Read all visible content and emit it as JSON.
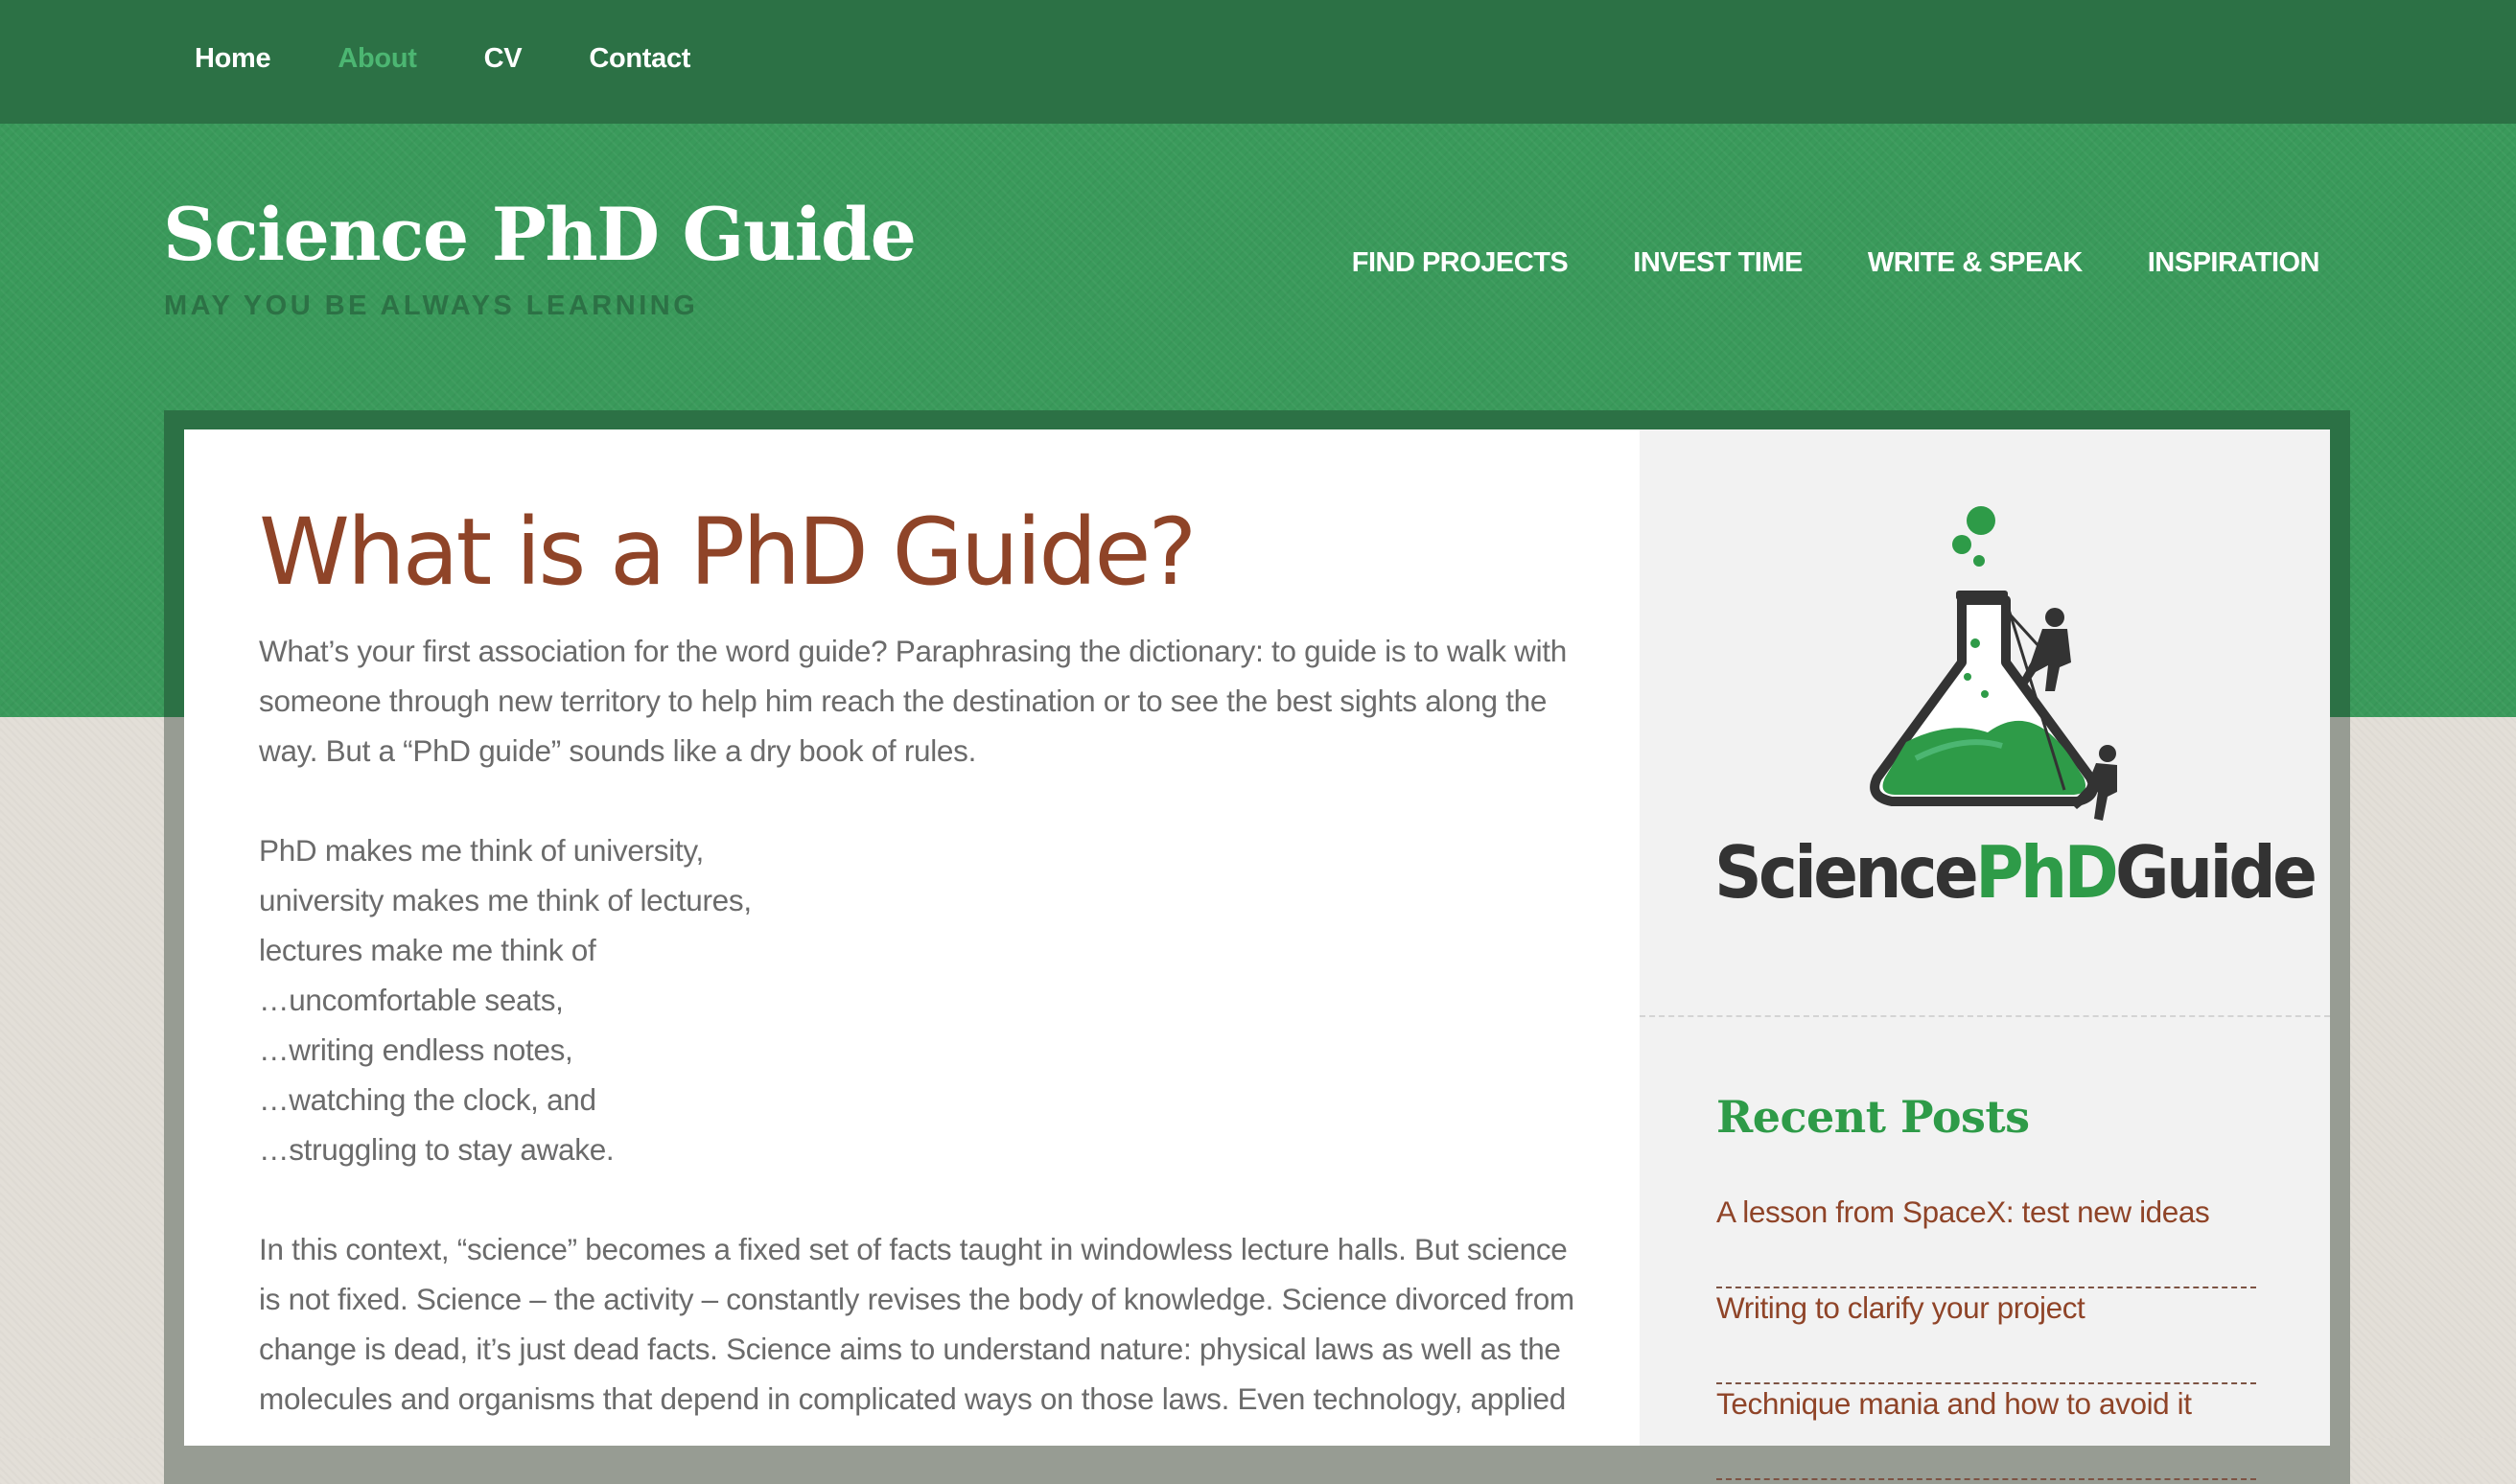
{
  "topnav": {
    "items": [
      {
        "label": "Home",
        "active": false
      },
      {
        "label": "About",
        "active": true
      },
      {
        "label": "CV",
        "active": false
      },
      {
        "label": "Contact",
        "active": false
      }
    ]
  },
  "site": {
    "title": "Science PhD Guide",
    "tagline": "MAY YOU BE ALWAYS LEARNING"
  },
  "mainnav": {
    "items": [
      "FIND PROJECTS",
      "INVEST TIME",
      "WRITE & SPEAK",
      "INSPIRATION"
    ]
  },
  "post": {
    "title": "What is a PhD Guide?",
    "para1": "What’s your first association for the word guide? Paraphrasing the dictionary: to guide is to walk with someone through new territory to help him reach the destination or to see the best sights along the way. But a “PhD guide” sounds like a dry book of rules.",
    "poem": [
      "PhD makes me think of university,",
      "university makes me think of lectures,",
      "lectures make me think of",
      "…uncomfortable seats,",
      "…writing endless notes,",
      "…watching the clock, and",
      "…struggling to stay awake."
    ],
    "para3": "In this context, “science” becomes a fixed set of facts taught in windowless lecture halls. But science is not fixed. Science – the activity – constantly revises the body of knowledge. Science divorced from change is dead, it’s just dead facts. Science aims to understand nature: physical laws as well as the molecules and organisms that depend in complicated ways on those laws. Even technology, applied"
  },
  "sidebar": {
    "logo": {
      "part1": "Science",
      "part2": "PhD",
      "part3": "Guide"
    },
    "recent_posts_title": "Recent Posts",
    "recent_posts": [
      "A lesson from SpaceX: test new ideas",
      "Writing to clarify your project",
      "Technique mania and how to avoid it"
    ]
  },
  "colors": {
    "topbar": "#2c7145",
    "hero": "#3a9a5b",
    "title_brown": "#8f4428",
    "accent_green": "#2e9b48"
  }
}
